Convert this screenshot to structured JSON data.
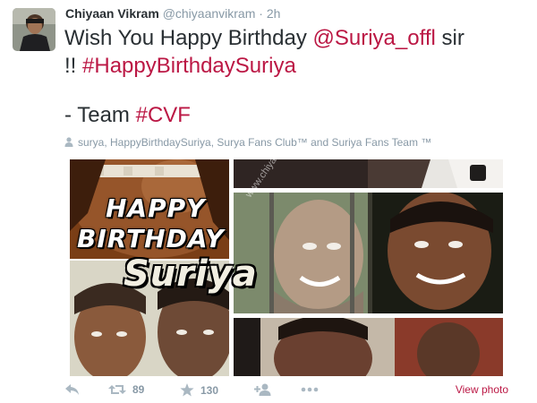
{
  "author": {
    "full_name": "Chiyaan Vikram",
    "handle": "@chiyaanvikram",
    "separator": "·",
    "time": "2h"
  },
  "tweet": {
    "line1_text": "Wish You Happy Birthday ",
    "mention": "@Suriya_offl",
    "line1_tail": " sir",
    "line2_text": "!! ",
    "hashtag1": "#HappyBirthdaySuriya",
    "line3_text": "- Team ",
    "hashtag2": "#CVF"
  },
  "context": {
    "icon": "person-icon",
    "text": "surya, HappyBirthdaySuriya, Surya Fans Club™ and Suriya Fans Team ™"
  },
  "media": {
    "overlay_line1": "HAPPY",
    "overlay_line2": "BIRTHDAY",
    "overlay_line3": "Suriya",
    "watermark": "www.chiyaanvikram"
  },
  "actions": {
    "retweet_count": "89",
    "favorite_count": "130",
    "view_photo_label": "View photo"
  },
  "colors": {
    "link": "#bb1744",
    "meta": "#8899a6",
    "text": "#292f33"
  }
}
